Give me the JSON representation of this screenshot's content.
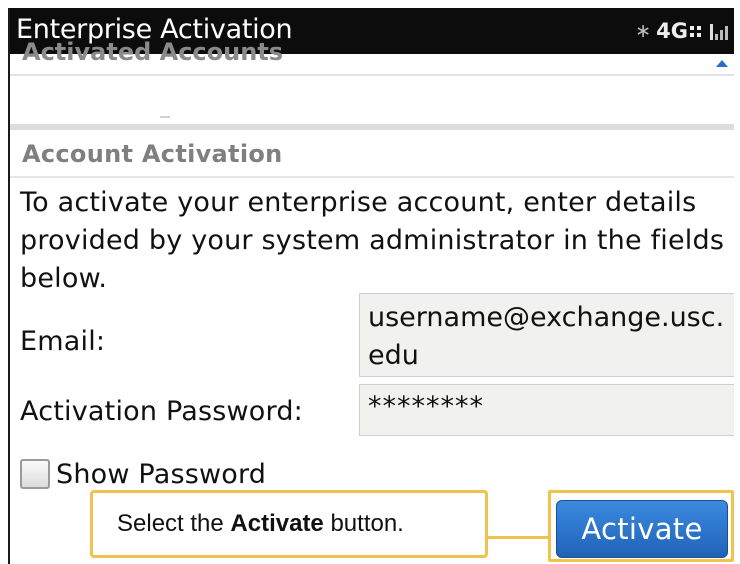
{
  "window": {
    "title": "Enterprise Activation"
  },
  "status": {
    "network": "4G",
    "bluetooth_icon": "bluetooth-icon",
    "signal_icon": "signal-strength-icon"
  },
  "previous_section": {
    "title": "Activated Accounts"
  },
  "section": {
    "title": "Account Activation",
    "description": "To activate your enterprise account, enter details provided by your system administrator in the fields below."
  },
  "form": {
    "email_label": "Email:",
    "email_value": "username@exchange.usc.edu",
    "password_label": "Activation Password:",
    "password_value": "********",
    "show_password_label": "Show Password",
    "show_password_checked": false
  },
  "callout": {
    "prefix": "Select the ",
    "bold": "Activate",
    "suffix": " button."
  },
  "buttons": {
    "activate": "Activate"
  },
  "colors": {
    "accent": "#2a6fc9",
    "highlight": "#f0c24e",
    "titlebar": "#0c0c0c"
  }
}
